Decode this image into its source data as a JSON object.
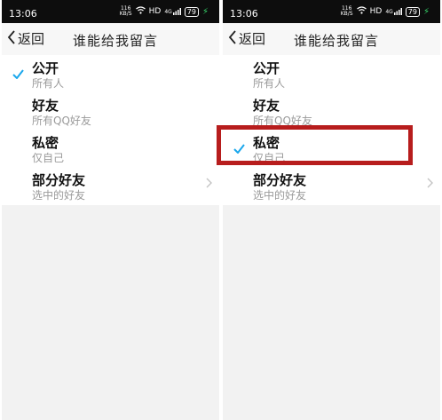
{
  "screens": [
    {
      "status": {
        "time": "13:06",
        "net_top": "116",
        "net_bottom": "KB/S",
        "hd": "HD",
        "signal": "4G",
        "battery": "79",
        "wifi_icon": "wifi-icon",
        "signal_icon": "signal-icon"
      },
      "nav": {
        "back_label": "返回",
        "title": "谁能给我留言",
        "back_icon": "chevron-left-icon"
      },
      "options": [
        {
          "title": "公开",
          "subtitle": "所有人",
          "checked": true,
          "has_arrow": false
        },
        {
          "title": "好友",
          "subtitle": "所有QQ好友",
          "checked": false,
          "has_arrow": false
        },
        {
          "title": "私密",
          "subtitle": "仅自己",
          "checked": false,
          "has_arrow": false
        },
        {
          "title": "部分好友",
          "subtitle": "选中的好友",
          "checked": false,
          "has_arrow": true
        }
      ]
    },
    {
      "status": {
        "time": "13:06",
        "net_top": "116",
        "net_bottom": "KB/S",
        "hd": "HD",
        "signal": "4G",
        "battery": "79",
        "wifi_icon": "wifi-icon",
        "signal_icon": "signal-icon"
      },
      "nav": {
        "back_label": "返回",
        "title": "谁能给我留言",
        "back_icon": "chevron-left-icon"
      },
      "options": [
        {
          "title": "公开",
          "subtitle": "所有人",
          "checked": false,
          "has_arrow": false
        },
        {
          "title": "好友",
          "subtitle": "所有QQ好友",
          "checked": false,
          "has_arrow": false
        },
        {
          "title": "私密",
          "subtitle": "仅自己",
          "checked": true,
          "has_arrow": false
        },
        {
          "title": "部分好友",
          "subtitle": "选中的好友",
          "checked": false,
          "has_arrow": true
        }
      ]
    }
  ],
  "colors": {
    "check": "#1aa7ec",
    "highlight_box": "#b71d1d",
    "status_bar": "#0d0d0d",
    "background": "#f2f2f2"
  },
  "icons": {
    "check": "checkmark-icon",
    "arrow": "chevron-right-icon",
    "charging": "charging-bolt-icon"
  }
}
